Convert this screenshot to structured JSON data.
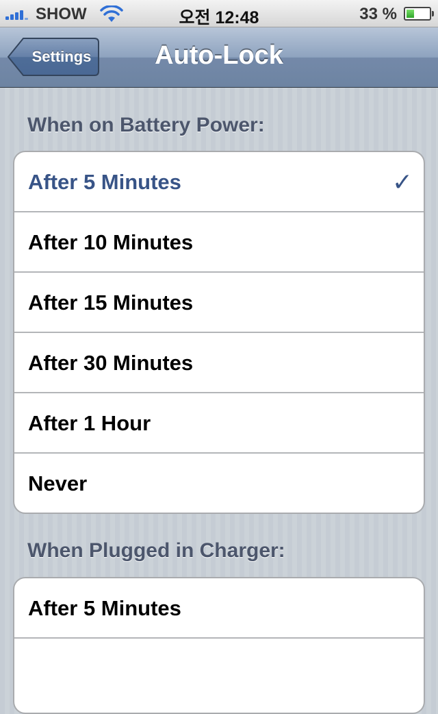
{
  "status_bar": {
    "carrier": "SHOW",
    "time": "오전 12:48",
    "battery_percent": "33 %",
    "battery_level": 0.33,
    "signal_icon": "signal-bars-icon",
    "wifi_icon": "wifi-icon",
    "battery_icon": "battery-icon"
  },
  "nav": {
    "back_label": "Settings",
    "title": "Auto-Lock"
  },
  "sections": [
    {
      "header": "When on Battery Power:",
      "items": [
        {
          "label": "After 5 Minutes",
          "selected": true
        },
        {
          "label": "After 10 Minutes",
          "selected": false
        },
        {
          "label": "After 15 Minutes",
          "selected": false
        },
        {
          "label": "After 30 Minutes",
          "selected": false
        },
        {
          "label": "After 1 Hour",
          "selected": false
        },
        {
          "label": "Never",
          "selected": false
        }
      ]
    },
    {
      "header": "When Plugged in Charger:",
      "items": [
        {
          "label": "After 5 Minutes",
          "selected": false
        },
        {
          "label": "",
          "selected": false
        }
      ]
    }
  ],
  "checkmark": "✓",
  "colors": {
    "selected_text": "#385487",
    "accent_blue": "#2f6fd6"
  }
}
